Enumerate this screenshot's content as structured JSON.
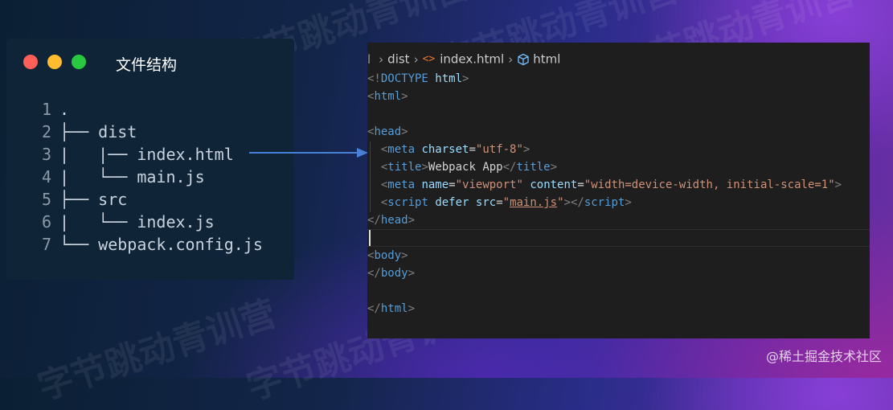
{
  "tree": {
    "title": "文件结构",
    "lines": [
      {
        "n": "1",
        "text": "."
      },
      {
        "n": "2",
        "text": "├── dist"
      },
      {
        "n": "3",
        "text": "|   |── index.html"
      },
      {
        "n": "4",
        "text": "|   └── main.js"
      },
      {
        "n": "5",
        "text": "├── src"
      },
      {
        "n": "6",
        "text": "|   └── index.js"
      },
      {
        "n": "7",
        "text": "└── webpack.config.js"
      }
    ]
  },
  "editor": {
    "breadcrumb": {
      "folder": "dist",
      "file": "index.html",
      "symbol": "html"
    },
    "code": {
      "doctype_open": "<!",
      "doctype_kw": "DOCTYPE",
      "doctype_name": " html",
      "doctype_close": ">",
      "html_tag": "html",
      "head_tag": "head",
      "meta_tag": "meta",
      "charset_attr": "charset",
      "charset_val": "\"utf-8\"",
      "title_tag": "title",
      "title_text": "Webpack App",
      "name_attr": "name",
      "name_val": "\"viewport\"",
      "content_attr": "content",
      "content_val": "\"width=device-width, initial-scale=1\"",
      "script_tag": "script",
      "defer_attr": "defer",
      "src_attr": "src",
      "src_val": "main.js",
      "body_tag": "body"
    }
  },
  "watermark": "字节跳动青训营",
  "credit": "@稀土掘金技术社区",
  "colors": {
    "close": "#ff5f57",
    "minimize": "#febc2e",
    "maximize": "#28c840",
    "arrow": "#4a7fd6"
  }
}
